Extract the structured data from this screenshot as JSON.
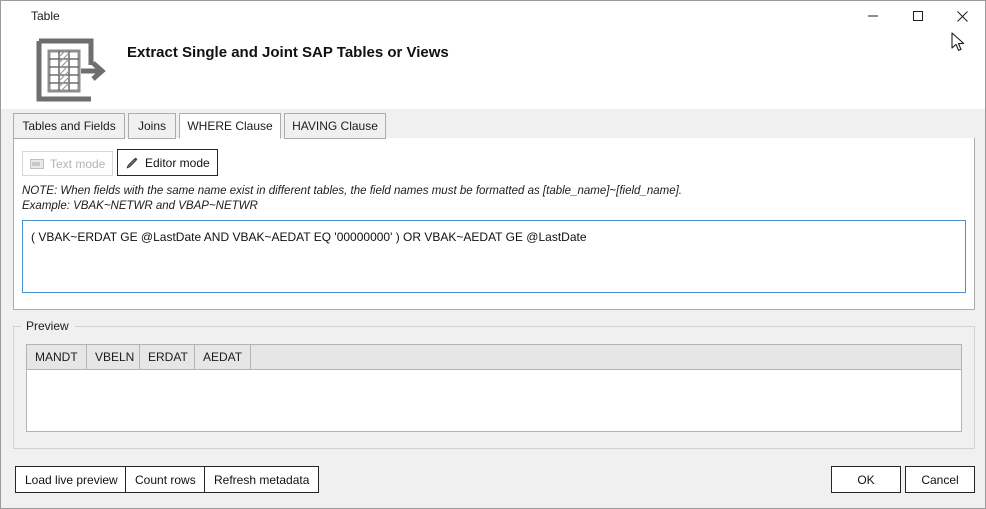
{
  "window": {
    "title": "Table",
    "controls": [
      {
        "name": "minimize",
        "label": "─"
      },
      {
        "name": "maximize",
        "label": "□"
      },
      {
        "name": "close",
        "label": "✕"
      }
    ]
  },
  "header": {
    "title": "Extract Single and Joint SAP Tables or Views",
    "icon": "table-export-icon"
  },
  "tabs": [
    {
      "label": "Tables and Fields",
      "active": false
    },
    {
      "label": "Joins",
      "active": false
    },
    {
      "label": "WHERE Clause",
      "active": true
    },
    {
      "label": "HAVING Clause",
      "active": false
    }
  ],
  "where_tab": {
    "mode_buttons": {
      "text_mode": {
        "label": "Text mode",
        "icon": "textbox-icon",
        "enabled": false
      },
      "editor_mode": {
        "label": "Editor mode",
        "icon": "pencil-icon",
        "enabled": true,
        "active": true
      }
    },
    "note_line1": "NOTE: When fields with the same name exist in different tables, the field names must be formatted as [table_name]~[field_name].",
    "note_line2": "Example: VBAK~NETWR and VBAP~NETWR",
    "where_clause": "( VBAK~ERDAT GE @LastDate AND VBAK~AEDAT EQ '00000000' ) OR VBAK~AEDAT GE @LastDate",
    "where_clause_placeholder": ""
  },
  "preview": {
    "legend": "Preview",
    "columns": [
      "MANDT",
      "VBELN",
      "ERDAT",
      "AEDAT"
    ],
    "rows": []
  },
  "footer": {
    "load_live_preview": "Load live preview",
    "count_rows": "Count rows",
    "refresh_metadata": "Refresh metadata",
    "ok": "OK",
    "cancel": "Cancel"
  },
  "colors": {
    "accent_border": "#4a90d0",
    "window_bg": "#f0f0f0",
    "panel_bg": "#ffffff",
    "icon_gray": "#6e6e6e"
  }
}
